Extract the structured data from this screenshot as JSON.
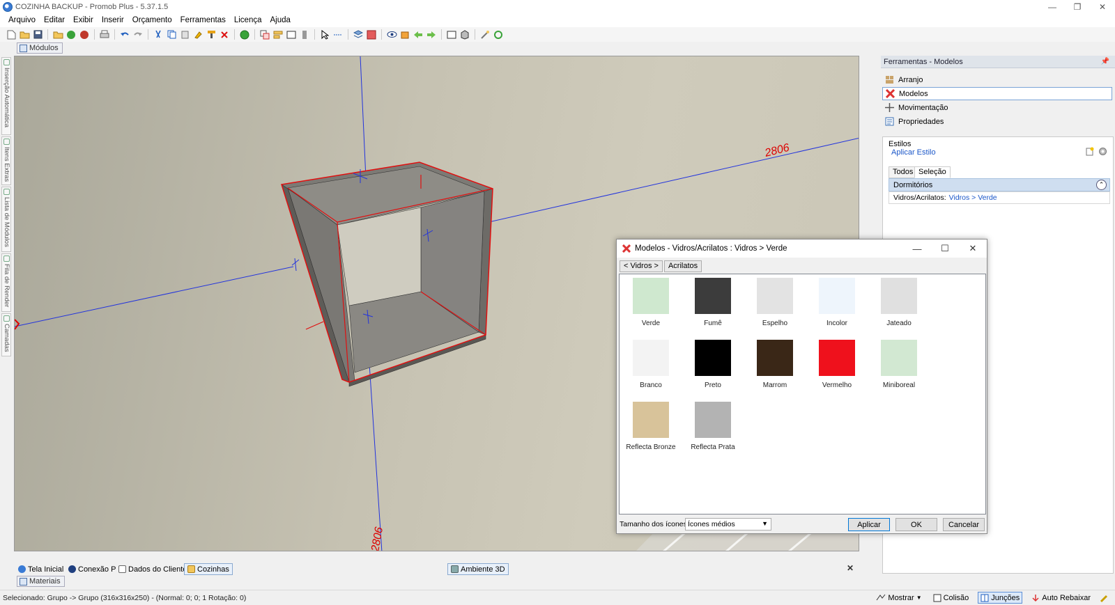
{
  "window": {
    "title": "COZINHA BACKUP - Promob Plus - 5.37.1.5",
    "controls": [
      "—",
      "❐",
      "✕"
    ]
  },
  "menu": [
    "Arquivo",
    "Editar",
    "Exibir",
    "Inserir",
    "Orçamento",
    "Ferramentas",
    "Licença",
    "Ajuda"
  ],
  "modules_tab": "Módulos",
  "left_dock": [
    "Inserção Automática",
    "Itens Extras",
    "Lista de Módulos",
    "Fila de Render",
    "Camadas"
  ],
  "viewport": {
    "dimension_1": "2806",
    "dimension_2": "2806"
  },
  "bottom_tabs": [
    "Tela Inicial",
    "Conexão P",
    "Dados do Cliente",
    "Cozinhas",
    "Ambiente 3D"
  ],
  "close_symbol": "✕",
  "materials_tab": "Materiais",
  "status": {
    "text": "Selecionado: Grupo -> Grupo (316x316x250) - (Normal: 0; 0; 1 Rotação: 0)",
    "mostrar": "Mostrar",
    "colisao": "Colisão",
    "juncoes": "Junções",
    "auto_rebaixar": "Auto Rebaixar"
  },
  "right_panel": {
    "title": "Ferramentas - Modelos",
    "pin": "📌",
    "nav": [
      "Arranjo",
      "Modelos",
      "Movimentação",
      "Propriedades"
    ],
    "styles_title": "Estilos",
    "apply_style": "Aplicar Estilo",
    "tabs": [
      "Todos",
      "Seleção"
    ],
    "group": "Dormitórios",
    "group_toggle": "⌃",
    "prop_label": "Vidros/Acrilatos:",
    "prop_value": "Vidros > Verde"
  },
  "dialog": {
    "title": "Modelos - Vidros/Acrilatos :  Vidros > Verde",
    "nav_back": "< Vidros >",
    "nav_current": "Acrilatos",
    "swatches": [
      {
        "name": "Verde",
        "color": "#cfe8cf"
      },
      {
        "name": "Fumê",
        "color": "#3c3c3c"
      },
      {
        "name": "Espelho",
        "color": "#e3e3e3"
      },
      {
        "name": "Incolor",
        "color": "#eef5fc"
      },
      {
        "name": "Jateado",
        "color": "#e0e0e0"
      },
      {
        "name": "Branco",
        "color": "#f3f3f3"
      },
      {
        "name": "Preto",
        "color": "#000000"
      },
      {
        "name": "Marrom",
        "color": "#3a2717"
      },
      {
        "name": "Vermelho",
        "color": "#ef111c"
      },
      {
        "name": "Miniboreal",
        "color": "#d2e8d2"
      },
      {
        "name": "Reflecta Bronze",
        "color": "#d8c39a"
      },
      {
        "name": "Reflecta Prata",
        "color": "#b3b3b3"
      }
    ],
    "icon_size_label": "Tamanho dos ícones",
    "icon_size_value": "Ícones médios",
    "buttons": {
      "apply": "Aplicar",
      "ok": "OK",
      "cancel": "Cancelar"
    }
  },
  "colors": {
    "accent": "#0078d7",
    "selection_red": "#e01010",
    "axis_blue": "#2233dd",
    "link": "#1a56c8"
  }
}
